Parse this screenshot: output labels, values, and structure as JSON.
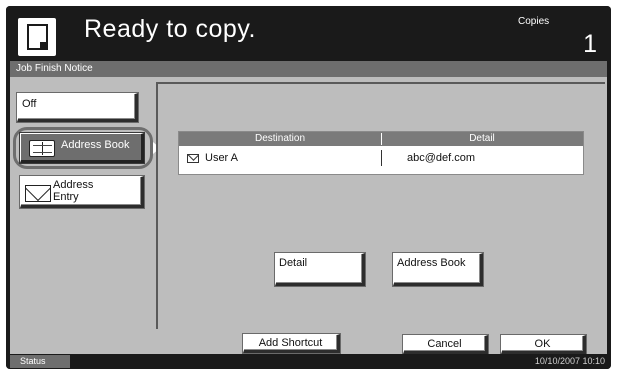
{
  "header": {
    "status_message": "Ready to copy.",
    "copies_label": "Copies",
    "copies_count": "1",
    "copy_icon": "copy-document-icon"
  },
  "screen_title": "Job Finish Notice",
  "left_options": {
    "off_label": "Off",
    "address_book_label": "Address Book",
    "address_entry_label": "Address Entry",
    "address_book_icon": "book-icon",
    "address_entry_icon": "envelope-icon",
    "selected": "Address Book"
  },
  "destination_table": {
    "columns": [
      "Destination",
      "Detail"
    ],
    "rows": [
      {
        "icon": "mail-icon",
        "destination": "User A",
        "detail": "abc@def.com"
      }
    ]
  },
  "actions": {
    "detail_label": "Detail",
    "address_book_label": "Address Book"
  },
  "bottom": {
    "add_shortcut_label": "Add Shortcut",
    "cancel_label": "Cancel",
    "ok_label": "OK"
  },
  "statusbar": {
    "status_label": "Status",
    "datetime": "10/10/2007   10:10"
  },
  "colors": {
    "header_bg": "#1a1a1a",
    "panel_bg": "#bdbdbd",
    "titlebar_bg": "#6e6e6e",
    "selected_button_bg": "#6e6e6e",
    "table_header_bg": "#7a7a7a"
  }
}
